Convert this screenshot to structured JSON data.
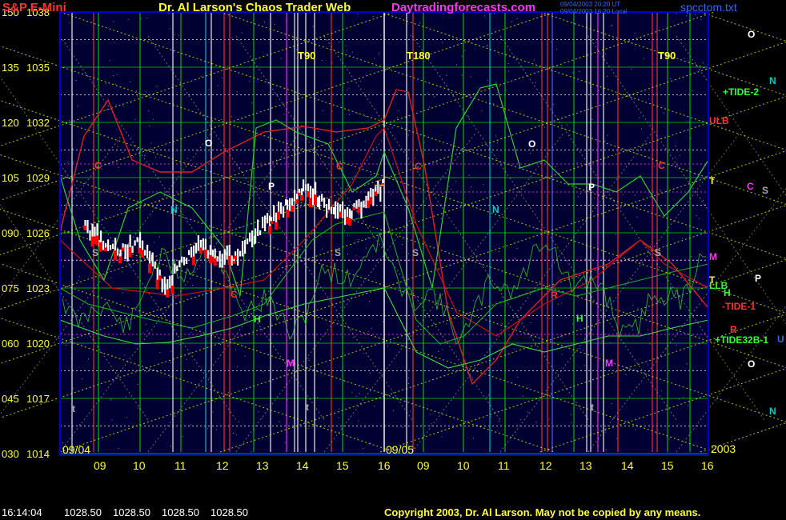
{
  "header": {
    "title_left": "S&P E-Mini",
    "title_center": "Dr. Al Larson's Chaos Trader Web",
    "site": "Daytradingforecasts.com",
    "stamp_line1": "09/04/2003 20:20 UT",
    "stamp_line2": "09/04/2003 16:20 Local",
    "file": "spcctom.txt"
  },
  "footer": {
    "time": "16:14:04",
    "ohlc": [
      "1028.50",
      "1028.50",
      "1028.50",
      "1028.50"
    ],
    "copyright": "Copyright 2003, Dr. Al Larson. May not be copied by any means."
  },
  "colors": {
    "background": "#000033",
    "frame": "#0000cc",
    "grid_white": "#ffffff",
    "grid_green": "#00cc00",
    "diag_yellow": "#ffff00",
    "price_bar": "#ffffff",
    "price_red": "#ff0000",
    "field_green": "#33cc33",
    "field_red": "#cc0000",
    "label_yellow": "#ffff33",
    "label_cyan": "#00cccc",
    "label_magenta": "#ff33ff"
  },
  "chart_data": {
    "type": "line",
    "title": "S&P E-Mini",
    "y_left_ticks": [
      "150",
      "135",
      "120",
      "105",
      "090",
      "075",
      "060",
      "045",
      "030"
    ],
    "y_right_ticks": [
      "1038",
      "1035",
      "1032",
      "1029",
      "1026",
      "1023",
      "1020",
      "1017",
      "1014"
    ],
    "ylim": [
      1014,
      1038
    ],
    "x_ticks": [
      "09",
      "10",
      "11",
      "12",
      "13",
      "14",
      "15",
      "16",
      "09",
      "10",
      "11",
      "12",
      "13",
      "14",
      "15",
      "16"
    ],
    "date_labels": [
      "09/04",
      "09/05",
      "2003"
    ],
    "timing_labels": [
      "T90",
      "T180",
      "T90"
    ],
    "in_chart_labels": [
      "C",
      "C",
      "C",
      "C",
      "C",
      "O",
      "O",
      "P",
      "P",
      "S",
      "S",
      "S",
      "S",
      "N",
      "N",
      "H",
      "H",
      "M",
      "M",
      "R",
      "t",
      "t",
      "t"
    ],
    "right_labels": [
      "O",
      "N",
      "+TIDE-2",
      "ULB",
      "T",
      "C",
      "S",
      "M",
      "T",
      "LLB",
      "P",
      "H",
      "-TIDE-1",
      "R",
      "+TIDE32B-1",
      "U",
      "O",
      "N"
    ],
    "series": [
      {
        "name": "price",
        "x": [
          8.6,
          9.0,
          9.5,
          10.0,
          10.3,
          10.6,
          11.0,
          11.4,
          11.8,
          12.3,
          12.8,
          13.2,
          13.6,
          14.0,
          14.4,
          14.8,
          15.2,
          15.6,
          16.0
        ],
        "values": [
          1026.3,
          1025.5,
          1024.8,
          1025.6,
          1024.3,
          1023.0,
          1024.2,
          1025.1,
          1024.8,
          1024.5,
          1025.8,
          1026.7,
          1027.4,
          1028.4,
          1027.8,
          1026.9,
          1027.1,
          1027.6,
          1028.5
        ]
      }
    ]
  }
}
